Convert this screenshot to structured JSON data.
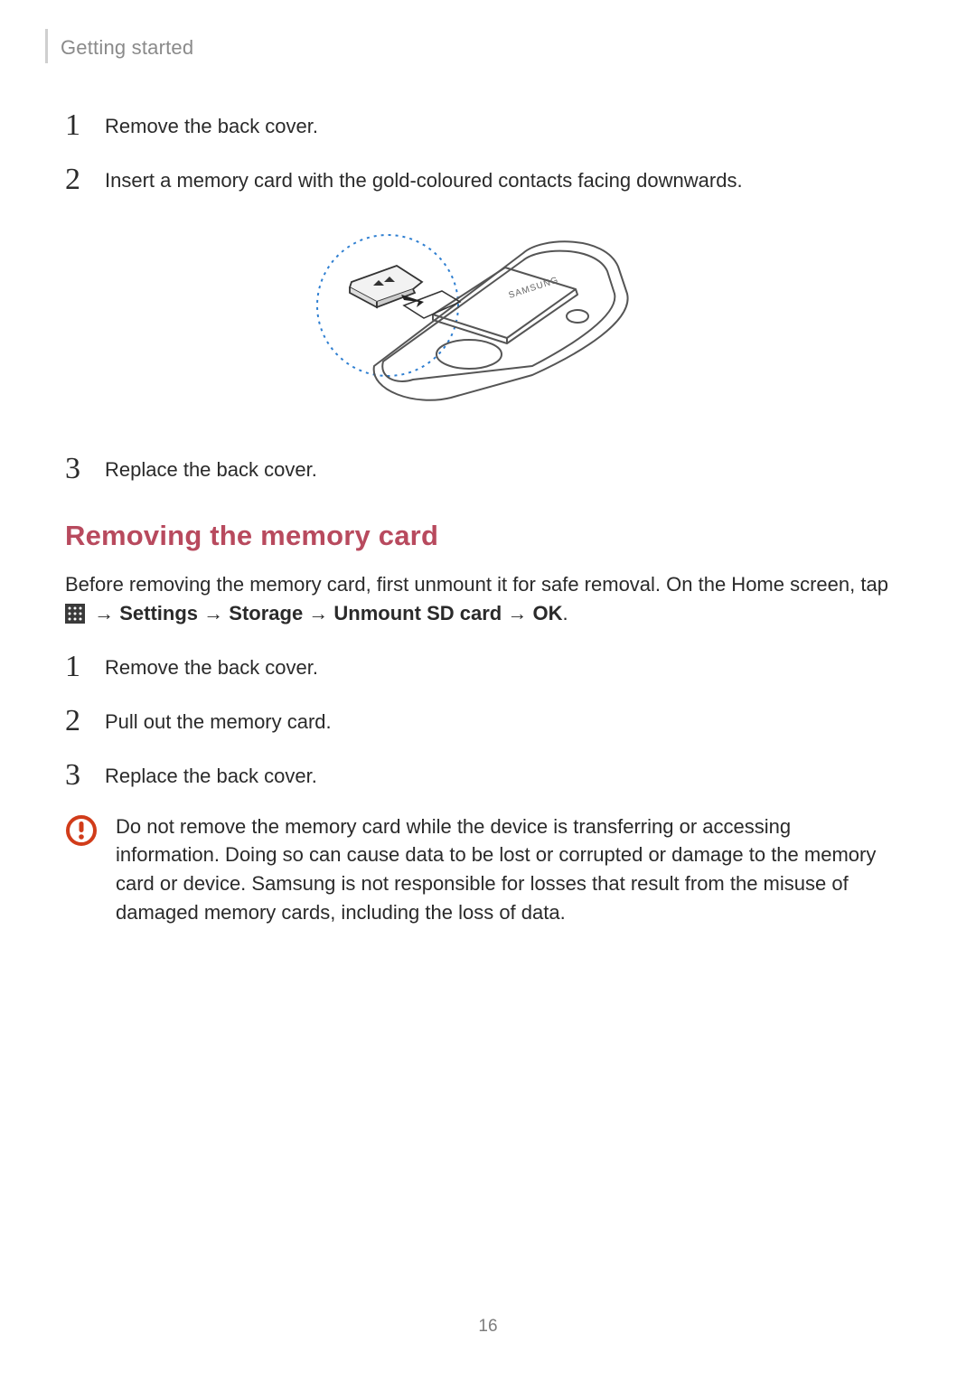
{
  "header": {
    "section": "Getting started"
  },
  "insert_steps": [
    {
      "num": "1",
      "text": "Remove the back cover."
    },
    {
      "num": "2",
      "text": "Insert a memory card with the gold-coloured contacts facing downwards."
    },
    {
      "num": "3",
      "text": "Replace the back cover."
    }
  ],
  "subheading": "Removing the memory card",
  "remove_intro": {
    "prefix": "Before removing the memory card, first unmount it for safe removal. On the Home screen, tap ",
    "arrow": " → ",
    "path_settings": "Settings",
    "path_storage": "Storage",
    "path_unmount": "Unmount SD card",
    "path_ok": "OK",
    "period": "."
  },
  "remove_steps": [
    {
      "num": "1",
      "text": "Remove the back cover."
    },
    {
      "num": "2",
      "text": "Pull out the memory card."
    },
    {
      "num": "3",
      "text": "Replace the back cover."
    }
  ],
  "caution": "Do not remove the memory card while the device is transferring or accessing information. Doing so can cause data to be lost or corrupted or damage to the memory card or device. Samsung is not responsible for losses that result from the misuse of damaged memory cards, including the loss of data.",
  "page_number": "16"
}
